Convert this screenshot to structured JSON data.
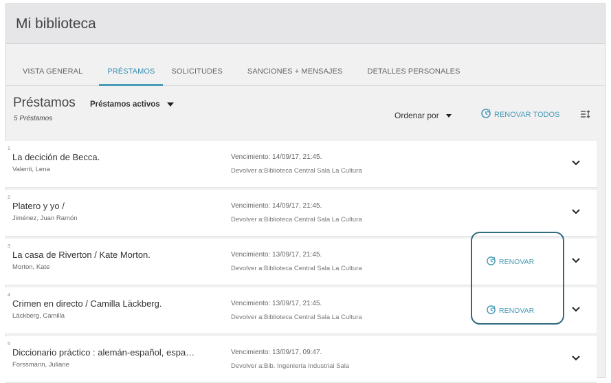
{
  "window": {
    "title": "Mi biblioteca"
  },
  "tabs": [
    {
      "label": "VISTA GENERAL",
      "active": false
    },
    {
      "label": "PRÉSTAMOS",
      "active": true
    },
    {
      "label": "SOLICITUDES",
      "active": false
    },
    {
      "label": "SANCIONES + MENSAJES",
      "active": false
    },
    {
      "label": "DETALLES PERSONALES",
      "active": false
    }
  ],
  "toolbar": {
    "title": "Préstamos",
    "filter": "Préstamos activos",
    "count": "5 Préstamos",
    "sort_label": "Ordenar por",
    "renew_all": "RENOVAR TODOS",
    "settings_icon": "column-settings-icon"
  },
  "loans": [
    {
      "index": "1",
      "title": "La decición de Becca.",
      "author": "Valenti, Lena",
      "due": "Vencimiento: 14/09/17, 21:45.",
      "return": "Devolver a:Biblioteca Central Sala La Cultura",
      "renew": ""
    },
    {
      "index": "2",
      "title": "Platero y yo /",
      "author": "Jiménez, Juan Ramón",
      "due": "Vencimiento: 14/09/17, 21:45.",
      "return": "Devolver a:Biblioteca Central Sala La Cultura",
      "renew": ""
    },
    {
      "index": "3",
      "title": "La casa de Riverton / Kate Morton.",
      "author": "Morton, Kate",
      "due": "Vencimiento: 13/09/17, 21:45.",
      "return": "Devolver a:Biblioteca Central Sala La Cultura",
      "renew": "RENOVAR"
    },
    {
      "index": "4",
      "title": "Crimen en directo / Camilla Läckberg.",
      "author": "Läckberg, Camilla",
      "due": "Vencimiento: 13/09/17, 21:45.",
      "return": "Devolver a:Biblioteca Central Sala La Cultura",
      "renew": "RENOVAR"
    },
    {
      "index": "5",
      "title": "Diccionario práctico : alemán-español, espa…",
      "author": "Forssmann, Juliane",
      "due": "Vencimiento: 13/09/17, 09:47.",
      "return": "Devolver a:Bib. Ingeniería Industrial Sala",
      "renew": ""
    }
  ],
  "colors": {
    "accent": "#4a9bb7",
    "highlight": "#2f6b7d"
  }
}
